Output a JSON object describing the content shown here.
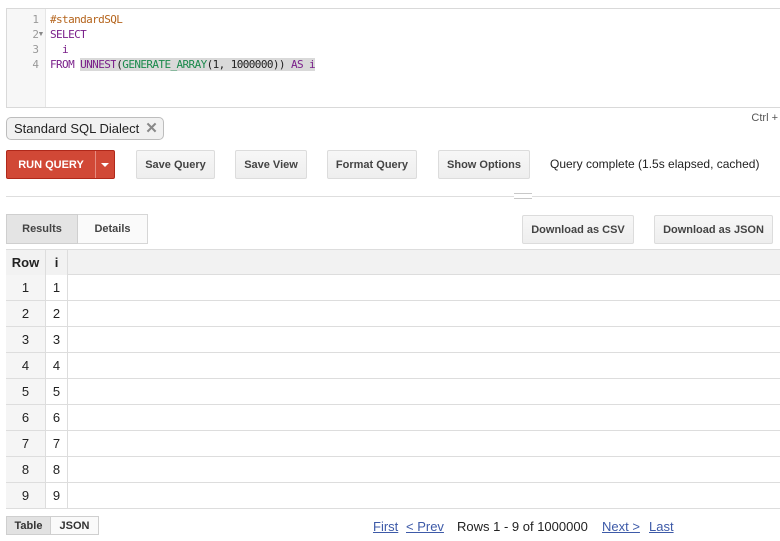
{
  "editor": {
    "line_numbers": [
      "1",
      "2",
      "3",
      "4"
    ],
    "lines": [
      {
        "tokens": [
          {
            "t": "#standardSQL",
            "c": "cm-comment"
          }
        ]
      },
      {
        "tokens": [
          {
            "t": "SELECT",
            "c": "cm-kw"
          }
        ]
      },
      {
        "tokens": [
          {
            "t": "  i",
            "c": "cm-kw"
          }
        ]
      },
      {
        "tokens": [
          {
            "t": "FROM ",
            "c": "cm-kw"
          },
          {
            "t": "UNNEST",
            "c": "cm-kw sel"
          },
          {
            "t": "(",
            "c": "cm-punc sel"
          },
          {
            "t": "GENERATE_ARRAY",
            "c": "cm-fn sel"
          },
          {
            "t": "(1, 1000000)) ",
            "c": "cm-num sel"
          },
          {
            "t": "AS",
            "c": "cm-kw sel"
          },
          {
            "t": " i",
            "c": "cm-kw sel"
          }
        ]
      }
    ],
    "shortcut_hint": "Ctrl +"
  },
  "dialect_chip": {
    "label": "Standard SQL Dialect",
    "remove_glyph": "✕"
  },
  "toolbar": {
    "run_label": "RUN QUERY",
    "save_query": "Save Query",
    "save_view": "Save View",
    "format_query": "Format Query",
    "show_options": "Show Options",
    "status": "Query complete (1.5s elapsed, cached)"
  },
  "results_tabs": {
    "results": "Results",
    "details": "Details"
  },
  "downloads": {
    "csv": "Download as CSV",
    "json": "Download as JSON"
  },
  "table": {
    "headers": [
      "Row",
      "i"
    ],
    "rows": [
      [
        "1",
        "1"
      ],
      [
        "2",
        "2"
      ],
      [
        "3",
        "3"
      ],
      [
        "4",
        "4"
      ],
      [
        "5",
        "5"
      ],
      [
        "6",
        "6"
      ],
      [
        "7",
        "7"
      ],
      [
        "8",
        "8"
      ],
      [
        "9",
        "9"
      ]
    ]
  },
  "view_tabs": {
    "table": "Table",
    "json": "JSON"
  },
  "pagination": {
    "first": "First",
    "prev": "< Prev",
    "summary": "Rows 1 - 9 of 1000000",
    "next": "Next >",
    "last": "Last"
  },
  "colors": {
    "run_button": "#d14836",
    "link": "#3d5aa8",
    "selection": "#d9d9d9"
  }
}
